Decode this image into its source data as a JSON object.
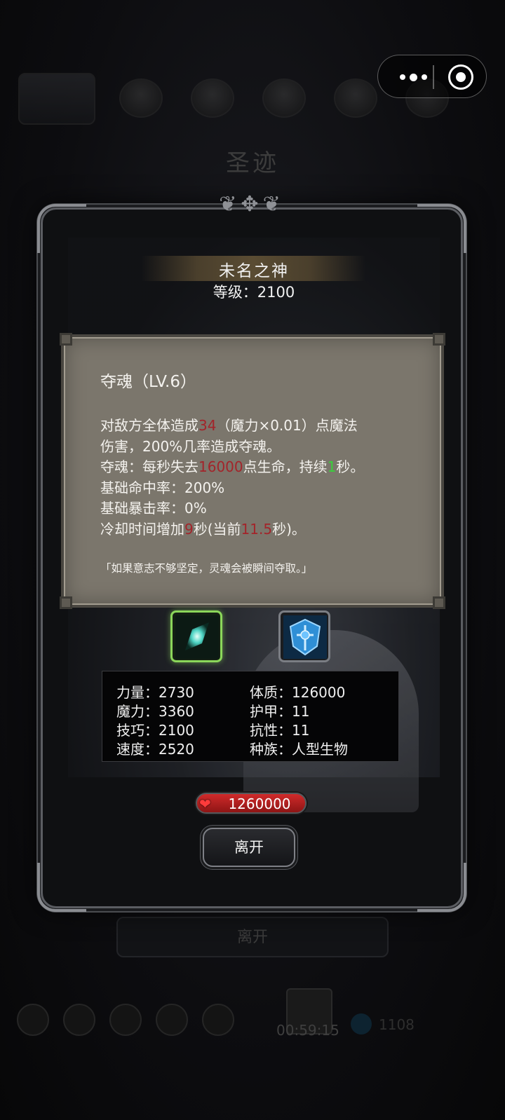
{
  "background": {
    "title": "圣迹",
    "leave_label": "离开",
    "timer": "00:59:15",
    "gem_value": "1108"
  },
  "boss": {
    "name": "未名之神",
    "level": "等级：2100"
  },
  "skill": {
    "title": "夺魂（LV.6）",
    "desc": {
      "l1_a": "对敌方全体造成",
      "l1_dmg": "34",
      "l1_b": "（魔力×0.01）点魔法",
      "l2": "伤害，200%几率造成夺魂。",
      "l3_a": "夺魂：每秒失去",
      "l3_hp": "16000",
      "l3_b": "点生命，持续",
      "l3_dur": "1",
      "l3_c": "秒。",
      "l4": "基础命中率：200%",
      "l5": "基础暴击率：0%",
      "l6_a": "冷却时间增加",
      "l6_add": "9",
      "l6_b": "秒(当前",
      "l6_cur": "11.5",
      "l6_c": "秒)。"
    },
    "quote": "「如果意志不够坚定，灵魂会被瞬间夺取。」"
  },
  "equipment": [
    {
      "icon": "crystal-shard-icon"
    },
    {
      "icon": "blue-shield-icon"
    }
  ],
  "attributes": {
    "strength": "力量：2730",
    "magic": "魔力：3360",
    "skill": "技巧：2100",
    "speed": "速度：2520",
    "constitution": "体质：126000",
    "armor": "护甲：11",
    "resistance": "抗性：11",
    "race": "种族：人型生物"
  },
  "hp": "1260000",
  "leave_button": "离开",
  "colors": {
    "highlight_red": "#a3242a",
    "highlight_green": "#38d13a",
    "panel_bg": "#7b766c"
  }
}
